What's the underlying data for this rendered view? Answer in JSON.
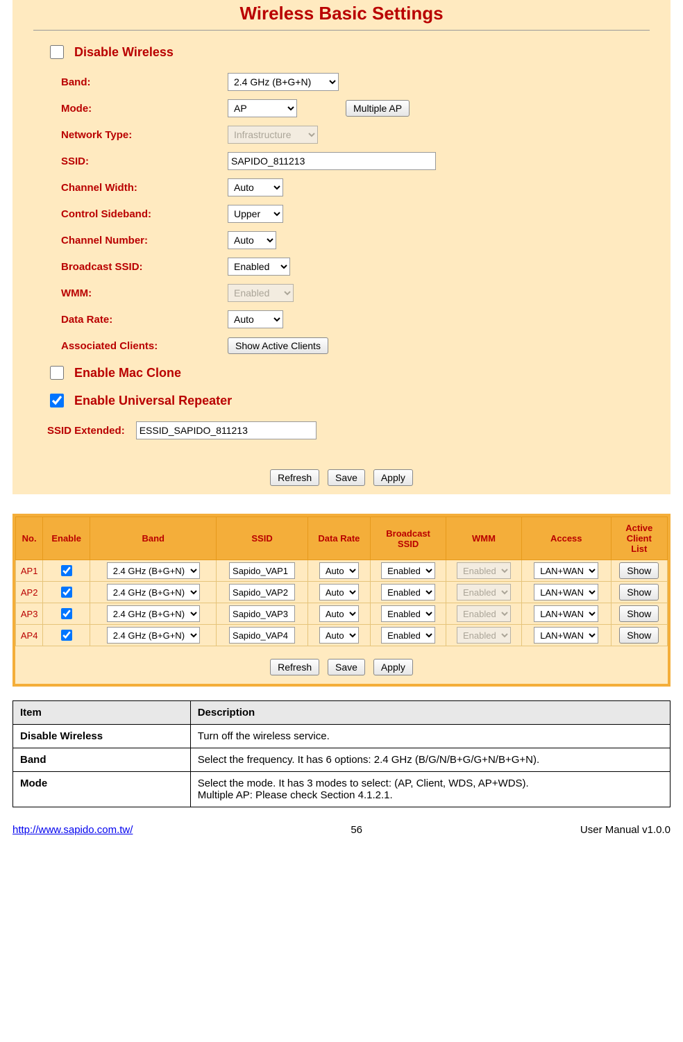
{
  "page": {
    "title": "Wireless Basic Settings"
  },
  "form": {
    "disable_wireless_label": "Disable Wireless",
    "fields": {
      "band_label": "Band:",
      "band_value": "2.4 GHz (B+G+N)",
      "mode_label": "Mode:",
      "mode_value": "AP",
      "multiple_ap_label": "Multiple AP",
      "network_type_label": "Network Type:",
      "network_type_value": "Infrastructure",
      "ssid_label": "SSID:",
      "ssid_value": "SAPIDO_811213",
      "channel_width_label": "Channel Width:",
      "channel_width_value": "Auto",
      "control_sideband_label": "Control Sideband:",
      "control_sideband_value": "Upper",
      "channel_number_label": "Channel Number:",
      "channel_number_value": "Auto",
      "broadcast_ssid_label": "Broadcast SSID:",
      "broadcast_ssid_value": "Enabled",
      "wmm_label": "WMM:",
      "wmm_value": "Enabled",
      "data_rate_label": "Data Rate:",
      "data_rate_value": "Auto",
      "associated_clients_label": "Associated Clients:",
      "show_active_clients_label": "Show Active Clients",
      "enable_mac_clone_label": "Enable Mac Clone",
      "enable_universal_repeater_label": "Enable Universal Repeater",
      "ssid_extended_label": "SSID Extended:",
      "ssid_extended_value": "ESSID_SAPIDO_811213"
    },
    "buttons": {
      "refresh": "Refresh",
      "save": "Save",
      "apply": "Apply"
    }
  },
  "vap": {
    "headers": {
      "no": "No.",
      "enable": "Enable",
      "band": "Band",
      "ssid": "SSID",
      "data_rate": "Data Rate",
      "broadcast_ssid": "Broadcast\nSSID",
      "wmm": "WMM",
      "access": "Access",
      "active_client_list": "Active\nClient\nList"
    },
    "rows": [
      {
        "no": "AP1",
        "enable": true,
        "band": "2.4 GHz (B+G+N)",
        "ssid": "Sapido_VAP1",
        "rate": "Auto",
        "bcast": "Enabled",
        "wmm": "Enabled",
        "access": "LAN+WAN",
        "show": "Show"
      },
      {
        "no": "AP2",
        "enable": true,
        "band": "2.4 GHz (B+G+N)",
        "ssid": "Sapido_VAP2",
        "rate": "Auto",
        "bcast": "Enabled",
        "wmm": "Enabled",
        "access": "LAN+WAN",
        "show": "Show"
      },
      {
        "no": "AP3",
        "enable": true,
        "band": "2.4 GHz (B+G+N)",
        "ssid": "Sapido_VAP3",
        "rate": "Auto",
        "bcast": "Enabled",
        "wmm": "Enabled",
        "access": "LAN+WAN",
        "show": "Show"
      },
      {
        "no": "AP4",
        "enable": true,
        "band": "2.4 GHz (B+G+N)",
        "ssid": "Sapido_VAP4",
        "rate": "Auto",
        "bcast": "Enabled",
        "wmm": "Enabled",
        "access": "LAN+WAN",
        "show": "Show"
      }
    ],
    "buttons": {
      "refresh": "Refresh",
      "save": "Save",
      "apply": "Apply"
    }
  },
  "desc_table": {
    "header_item": "Item",
    "header_desc": "Description",
    "rows": [
      {
        "item": "Disable Wireless",
        "desc": "Turn off the wireless service."
      },
      {
        "item": "Band",
        "desc": "Select the frequency. It has 6 options: 2.4 GHz (B/G/N/B+G/G+N/B+G+N)."
      },
      {
        "item": "Mode",
        "desc": "Select the mode. It has 3 modes to select: (AP, Client, WDS, AP+WDS).\nMultiple AP: Please check Section 4.1.2.1."
      }
    ]
  },
  "footer": {
    "url": "http://www.sapido.com.tw/",
    "page_number": "56",
    "version": "User  Manual  v1.0.0"
  }
}
